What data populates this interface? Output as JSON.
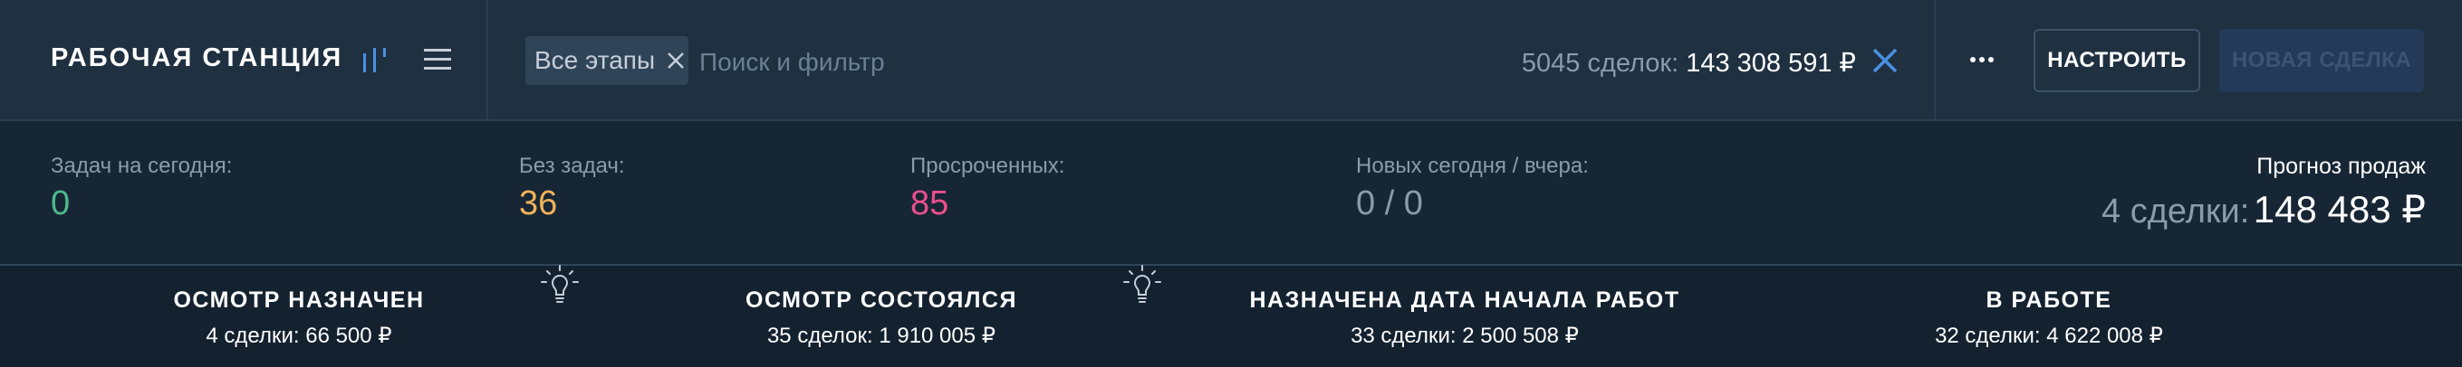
{
  "header": {
    "title": "РАБОЧАЯ СТАНЦИЯ",
    "icons": {
      "view_toggle": "pipeline-view-icon",
      "menu": "hamburger-menu-icon"
    }
  },
  "filter": {
    "chip_label": "Все этапы",
    "search_placeholder": "Поиск и фильтр",
    "count_label": "5045 сделок:",
    "count_sum": "143 308 591 ₽"
  },
  "toolbar": {
    "setup_label": "НАСТРОИТЬ",
    "new_deal_label": "НОВАЯ СДЕЛКА"
  },
  "stats": {
    "tasks_today": {
      "label": "Задач на сегодня:",
      "value": "0"
    },
    "no_tasks": {
      "label": "Без задач:",
      "value": "36"
    },
    "overdue": {
      "label": "Просроченных:",
      "value": "85"
    },
    "new_today_yesterday": {
      "label": "Новых сегодня / вчера:",
      "value": "0 / 0"
    }
  },
  "forecast": {
    "title": "Прогноз продаж",
    "count": "4 сделки:",
    "sum": "148 483 ₽"
  },
  "stages": [
    {
      "name": "ОСМОТР НАЗНАЧЕН",
      "summary": "4 сделки: 66 500 ₽"
    },
    {
      "name": "ОСМОТР СОСТОЯЛСЯ",
      "summary": "35 сделок: 1 910 005 ₽"
    },
    {
      "name": "НАЗНАЧЕНА ДАТА НАЧАЛА РАБОТ",
      "summary": "33 сделки: 2 500 508 ₽"
    },
    {
      "name": "В РАБОТЕ",
      "summary": "32 сделки: 4 622 008 ₽"
    }
  ],
  "colors": {
    "accent_blue": "#4a90e2",
    "green": "#4db98c",
    "orange": "#f0b25a",
    "pink": "#ea4f8e",
    "muted": "#8c9baa"
  }
}
